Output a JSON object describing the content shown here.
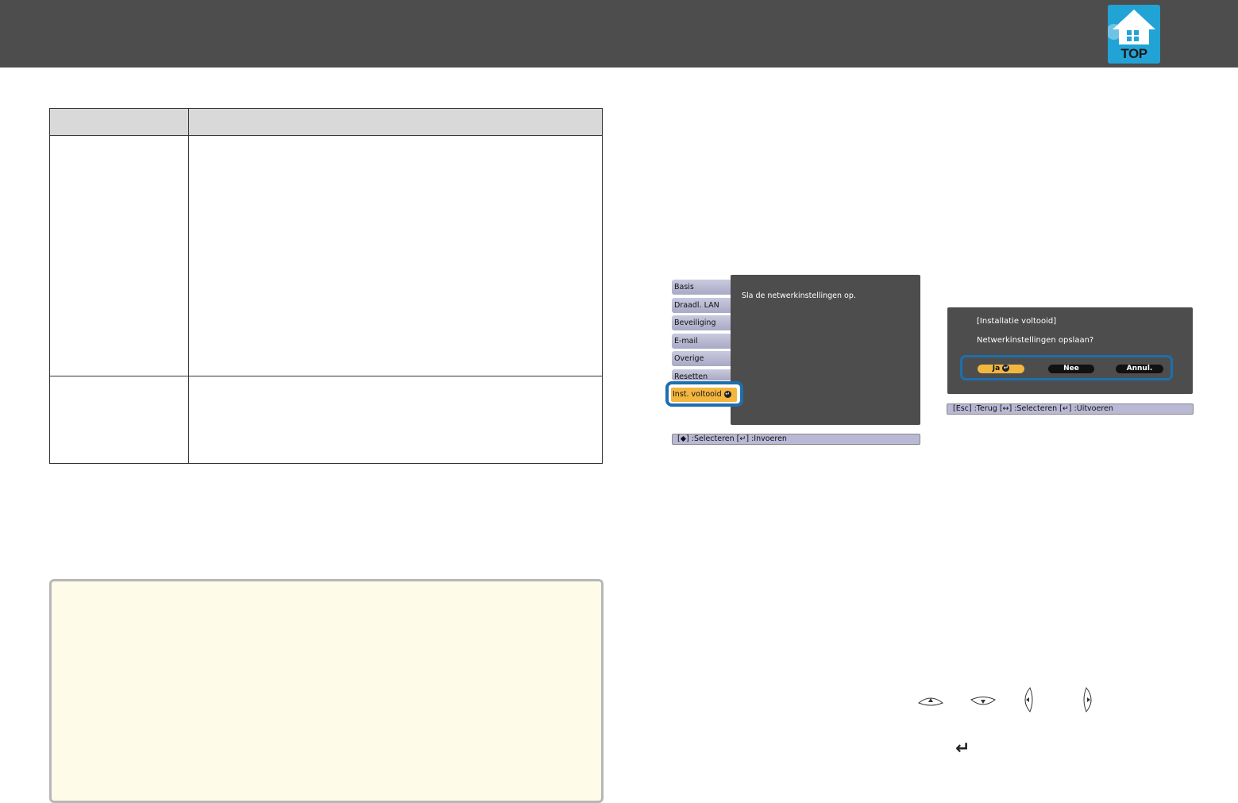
{
  "header": {
    "logo_text": "TOP",
    "colors": {
      "bar": "#4d4d4d",
      "logo": "#22a3d6"
    }
  },
  "menu_screenshot": {
    "side_items": [
      "Basis",
      "Draadl. LAN",
      "Beveiliging",
      "E-mail",
      "Overige",
      "Resetten"
    ],
    "selected_item": "Inst. voltooid",
    "panel_text": "Sla de netwerkinstellingen op.",
    "footer": "[◆] :Selecteren [↵] :Invoeren",
    "colors": {
      "highlight": "#1d6fae",
      "selected": "#f3b63f"
    }
  },
  "dialog_screenshot": {
    "title": "[Installatie voltooid]",
    "question": "Netwerkinstellingen opslaan?",
    "buttons": {
      "yes": "Ja",
      "no": "Nee",
      "cancel": "Annul."
    },
    "footer": "[Esc] :Terug [↔] :Selecteren [↵] :Uitvoeren"
  },
  "remote_icons": [
    "up-arrow-button-icon",
    "down-arrow-button-icon",
    "left-arrow-button-icon",
    "right-arrow-button-icon",
    "enter-button-icon"
  ]
}
